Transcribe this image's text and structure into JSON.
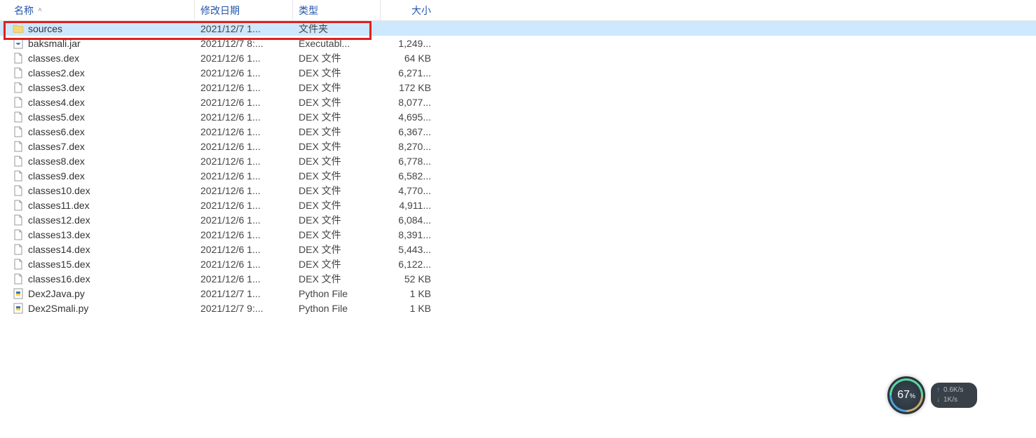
{
  "columns": {
    "name": "名称",
    "date": "修改日期",
    "type": "类型",
    "size": "大小"
  },
  "files": [
    {
      "icon": "folder",
      "name": "sources",
      "date": "2021/12/7 1...",
      "type": "文件夹",
      "size": "",
      "selected": true
    },
    {
      "icon": "jar",
      "name": "baksmali.jar",
      "date": "2021/12/7 8:...",
      "type": "Executabl...",
      "size": "1,249..."
    },
    {
      "icon": "file",
      "name": "classes.dex",
      "date": "2021/12/6 1...",
      "type": "DEX 文件",
      "size": "64 KB"
    },
    {
      "icon": "file",
      "name": "classes2.dex",
      "date": "2021/12/6 1...",
      "type": "DEX 文件",
      "size": "6,271..."
    },
    {
      "icon": "file",
      "name": "classes3.dex",
      "date": "2021/12/6 1...",
      "type": "DEX 文件",
      "size": "172 KB"
    },
    {
      "icon": "file",
      "name": "classes4.dex",
      "date": "2021/12/6 1...",
      "type": "DEX 文件",
      "size": "8,077..."
    },
    {
      "icon": "file",
      "name": "classes5.dex",
      "date": "2021/12/6 1...",
      "type": "DEX 文件",
      "size": "4,695..."
    },
    {
      "icon": "file",
      "name": "classes6.dex",
      "date": "2021/12/6 1...",
      "type": "DEX 文件",
      "size": "6,367..."
    },
    {
      "icon": "file",
      "name": "classes7.dex",
      "date": "2021/12/6 1...",
      "type": "DEX 文件",
      "size": "8,270..."
    },
    {
      "icon": "file",
      "name": "classes8.dex",
      "date": "2021/12/6 1...",
      "type": "DEX 文件",
      "size": "6,778..."
    },
    {
      "icon": "file",
      "name": "classes9.dex",
      "date": "2021/12/6 1...",
      "type": "DEX 文件",
      "size": "6,582..."
    },
    {
      "icon": "file",
      "name": "classes10.dex",
      "date": "2021/12/6 1...",
      "type": "DEX 文件",
      "size": "4,770..."
    },
    {
      "icon": "file",
      "name": "classes11.dex",
      "date": "2021/12/6 1...",
      "type": "DEX 文件",
      "size": "4,911..."
    },
    {
      "icon": "file",
      "name": "classes12.dex",
      "date": "2021/12/6 1...",
      "type": "DEX 文件",
      "size": "6,084..."
    },
    {
      "icon": "file",
      "name": "classes13.dex",
      "date": "2021/12/6 1...",
      "type": "DEX 文件",
      "size": "8,391..."
    },
    {
      "icon": "file",
      "name": "classes14.dex",
      "date": "2021/12/6 1...",
      "type": "DEX 文件",
      "size": "5,443..."
    },
    {
      "icon": "file",
      "name": "classes15.dex",
      "date": "2021/12/6 1...",
      "type": "DEX 文件",
      "size": "6,122..."
    },
    {
      "icon": "file",
      "name": "classes16.dex",
      "date": "2021/12/6 1...",
      "type": "DEX 文件",
      "size": "52 KB"
    },
    {
      "icon": "py",
      "name": "Dex2Java.py",
      "date": "2021/12/7 1...",
      "type": "Python File",
      "size": "1 KB"
    },
    {
      "icon": "py",
      "name": "Dex2Smali.py",
      "date": "2021/12/7 9:...",
      "type": "Python File",
      "size": "1 KB"
    }
  ],
  "widget": {
    "percent": "67",
    "percent_suffix": "%",
    "upload": "0.6K/s",
    "download": "1K/s"
  }
}
